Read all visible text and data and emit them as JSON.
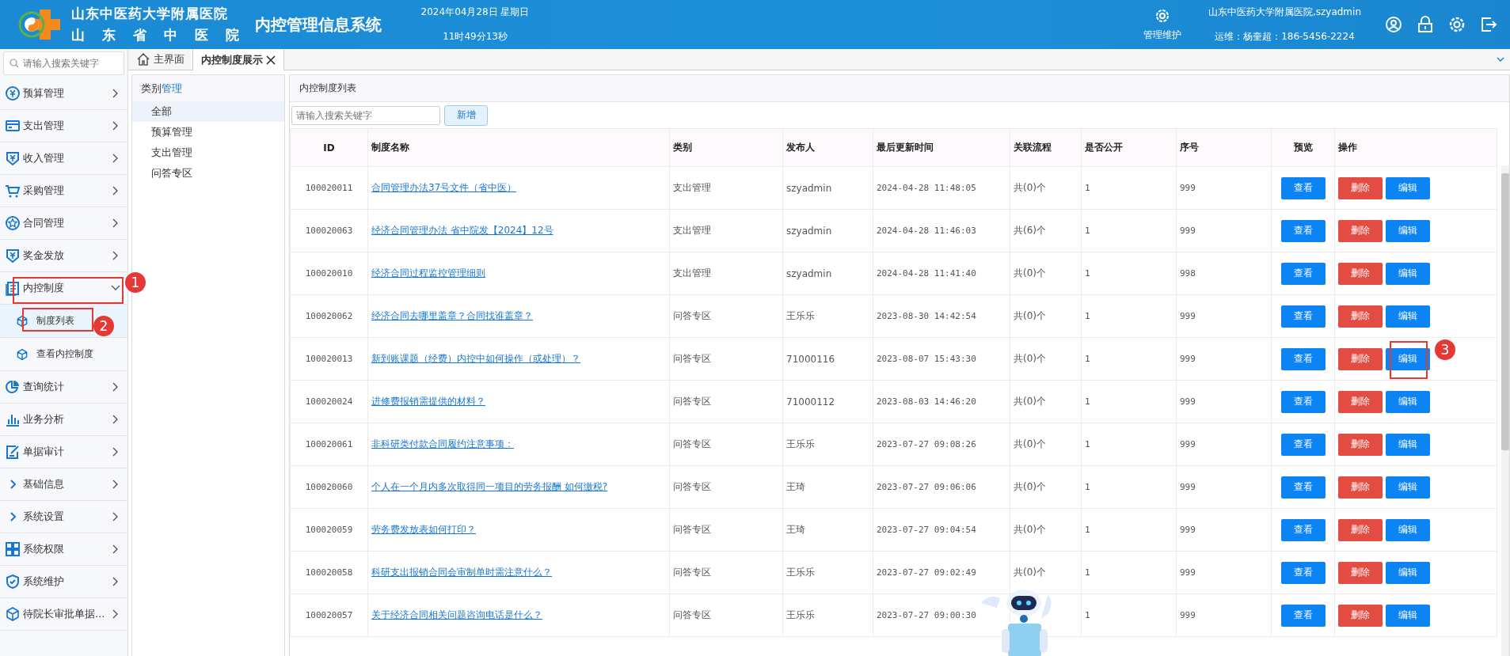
{
  "header": {
    "hospital_line1": "山东中医药大学附属医院",
    "hospital_line2": "山 东 省 中 医 院",
    "system_name": "内控管理信息系统",
    "date": "2024年04月28日 星期日",
    "time": "11时49分13秒",
    "maintenance": "管理维护",
    "user": "山东中医药大学附属医院,szyadmin",
    "support": "运维：杨奎超：186-5456-2224"
  },
  "sidebar": {
    "search_placeholder": "请输入搜索关键字",
    "items": [
      {
        "label": "预算管理",
        "expanded": false
      },
      {
        "label": "支出管理",
        "expanded": false
      },
      {
        "label": "收入管理",
        "expanded": false
      },
      {
        "label": "采购管理",
        "expanded": false
      },
      {
        "label": "合同管理",
        "expanded": false
      },
      {
        "label": "奖金发放",
        "expanded": false
      },
      {
        "label": "内控制度",
        "expanded": true,
        "annotation": "1",
        "children": [
          {
            "label": "制度列表",
            "selected": true,
            "annotation": "2"
          },
          {
            "label": "查看内控制度",
            "selected": false
          }
        ]
      },
      {
        "label": "查询统计",
        "expanded": false
      },
      {
        "label": "业务分析",
        "expanded": false
      },
      {
        "label": "单据审计",
        "expanded": false
      },
      {
        "label": "基础信息",
        "expanded": false
      },
      {
        "label": "系统设置",
        "expanded": false
      },
      {
        "label": "系统权限",
        "expanded": false
      },
      {
        "label": "系统维护",
        "expanded": false
      },
      {
        "label": "待院长审批单据...",
        "expanded": false
      }
    ]
  },
  "tabs": [
    {
      "label": "主界面",
      "kind": "home",
      "selected": false
    },
    {
      "label": "内控制度展示",
      "kind": "closable",
      "selected": true
    }
  ],
  "categories": {
    "title": "类别",
    "title_accent": "管理",
    "items": [
      {
        "label": "全部",
        "selected": true
      },
      {
        "label": "预算管理",
        "selected": false
      },
      {
        "label": "支出管理",
        "selected": false
      },
      {
        "label": "问答专区",
        "selected": false
      }
    ]
  },
  "list": {
    "title": "内控制度列表",
    "search_placeholder": "请输入搜索关键字",
    "add_button": "新增",
    "columns": [
      "ID",
      "制度名称",
      "类别",
      "发布人",
      "最后更新时间",
      "关联流程",
      "是否公开",
      "序号",
      "预览",
      "操作"
    ],
    "rows": [
      {
        "id": "100020011",
        "name": "合同管理办法37号文件（省中医）",
        "category": "支出管理",
        "publisher": "szyadmin",
        "updated": "2024-04-28 11:48:05",
        "flows": "共(0)个",
        "public": "1",
        "order": "999",
        "view": "查看",
        "delete": "删除",
        "edit": "编辑"
      },
      {
        "id": "100020063",
        "name": "经济合同管理办法 省中院发【2024】12号",
        "category": "支出管理",
        "publisher": "szyadmin",
        "updated": "2024-04-28 11:46:03",
        "flows": "共(6)个",
        "public": "1",
        "order": "999",
        "view": "查看",
        "delete": "删除",
        "edit": "编辑"
      },
      {
        "id": "100020010",
        "name": "经济合同过程监控管理细则",
        "category": "支出管理",
        "publisher": "szyadmin",
        "updated": "2024-04-28 11:41:40",
        "flows": "共(0)个",
        "public": "1",
        "order": "998",
        "view": "查看",
        "delete": "删除",
        "edit": "编辑"
      },
      {
        "id": "100020062",
        "name": "经济合同去哪里盖章？合同找谁盖章？",
        "category": "问答专区",
        "publisher": "王乐乐",
        "updated": "2023-08-30 14:42:54",
        "flows": "共(0)个",
        "public": "1",
        "order": "999",
        "view": "查看",
        "delete": "删除",
        "edit": "编辑"
      },
      {
        "id": "100020013",
        "name": "新到账课题（经费）内控中如何操作（或处理）？",
        "category": "问答专区",
        "publisher": "71000116",
        "updated": "2023-08-07 15:43:30",
        "flows": "共(0)个",
        "public": "1",
        "order": "999",
        "view": "查看",
        "delete": "删除",
        "edit": "编辑",
        "annotation": "3"
      },
      {
        "id": "100020024",
        "name": "进修费报销需提供的材料？",
        "category": "问答专区",
        "publisher": "71000112",
        "updated": "2023-08-03 14:46:20",
        "flows": "共(0)个",
        "public": "1",
        "order": "999",
        "view": "查看",
        "delete": "删除",
        "edit": "编辑"
      },
      {
        "id": "100020061",
        "name": "非科研类付款合同履约注意事项：",
        "category": "问答专区",
        "publisher": "王乐乐",
        "updated": "2023-07-27 09:08:26",
        "flows": "共(0)个",
        "public": "1",
        "order": "999",
        "view": "查看",
        "delete": "删除",
        "edit": "编辑"
      },
      {
        "id": "100020060",
        "name": "个人在一个月内多次取得同一项目的劳务报酬 如何缴税?",
        "category": "问答专区",
        "publisher": "王琦",
        "updated": "2023-07-27 09:06:06",
        "flows": "共(0)个",
        "public": "1",
        "order": "999",
        "view": "查看",
        "delete": "删除",
        "edit": "编辑"
      },
      {
        "id": "100020059",
        "name": "劳务费发放表如何打印？",
        "category": "问答专区",
        "publisher": "王琦",
        "updated": "2023-07-27 09:04:54",
        "flows": "共(0)个",
        "public": "1",
        "order": "999",
        "view": "查看",
        "delete": "删除",
        "edit": "编辑"
      },
      {
        "id": "100020058",
        "name": "科研支出报销合同会审制单时需注意什么？",
        "category": "问答专区",
        "publisher": "王乐乐",
        "updated": "2023-07-27 09:02:49",
        "flows": "共(0)个",
        "public": "1",
        "order": "999",
        "view": "查看",
        "delete": "删除",
        "edit": "编辑"
      },
      {
        "id": "100020057",
        "name": "关于经济合同相关问题咨询电话是什么？",
        "category": "问答专区",
        "publisher": "王乐乐",
        "updated": "2023-07-27 09:00:30",
        "public": "1",
        "order": "999",
        "view": "查看",
        "delete": "删除",
        "edit": "编辑"
      }
    ]
  }
}
